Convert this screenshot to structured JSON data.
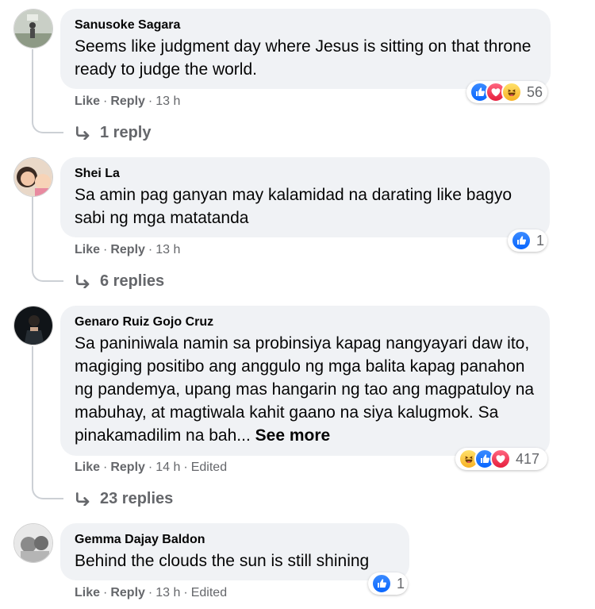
{
  "colors": {
    "bubble": "#f0f2f5",
    "meta": "#65676b",
    "like": "#0866ff",
    "love": "#e61e3d",
    "haha": "#f7b125"
  },
  "comments": [
    {
      "author": "Sanusoke Sagara",
      "text": "Seems like judgment day where Jesus is sitting on that throne ready to judge the world.",
      "like_label": "Like",
      "reply_label": "Reply",
      "time": "13 h",
      "reactions": {
        "icons": [
          "like-icon",
          "love-icon",
          "haha-icon"
        ],
        "count": "56"
      },
      "replies": "1 reply"
    },
    {
      "author": "Shei La",
      "text": "Sa amin pag ganyan may kalamidad na darating like bagyo sabi ng mga matatanda",
      "like_label": "Like",
      "reply_label": "Reply",
      "time": "13 h",
      "reactions": {
        "icons": [
          "like-icon"
        ],
        "count": "1"
      },
      "replies": "6 replies"
    },
    {
      "author": "Genaro Ruiz Gojo Cruz",
      "text": "Sa paniniwala namin sa probinsiya kapag nangyayari daw ito, magiging positibo ang anggulo ng mga balita kapag panahon ng pandemya, upang mas hangarin ng tao ang magpatuloy na mabuhay, at magtiwala kahit gaano na siya kalugmok. Sa pinakamadilim na bah...",
      "see_more": "See more",
      "like_label": "Like",
      "reply_label": "Reply",
      "time": "14 h",
      "edited": "Edited",
      "reactions": {
        "icons": [
          "haha-icon",
          "like-icon",
          "love-icon"
        ],
        "count": "417"
      },
      "replies": "23 replies"
    },
    {
      "author": "Gemma Dajay Baldon",
      "text": "Behind the clouds the sun is still shining",
      "like_label": "Like",
      "reply_label": "Reply",
      "time": "13 h",
      "edited": "Edited",
      "reactions": {
        "icons": [
          "like-icon"
        ],
        "count": "1"
      }
    }
  ]
}
